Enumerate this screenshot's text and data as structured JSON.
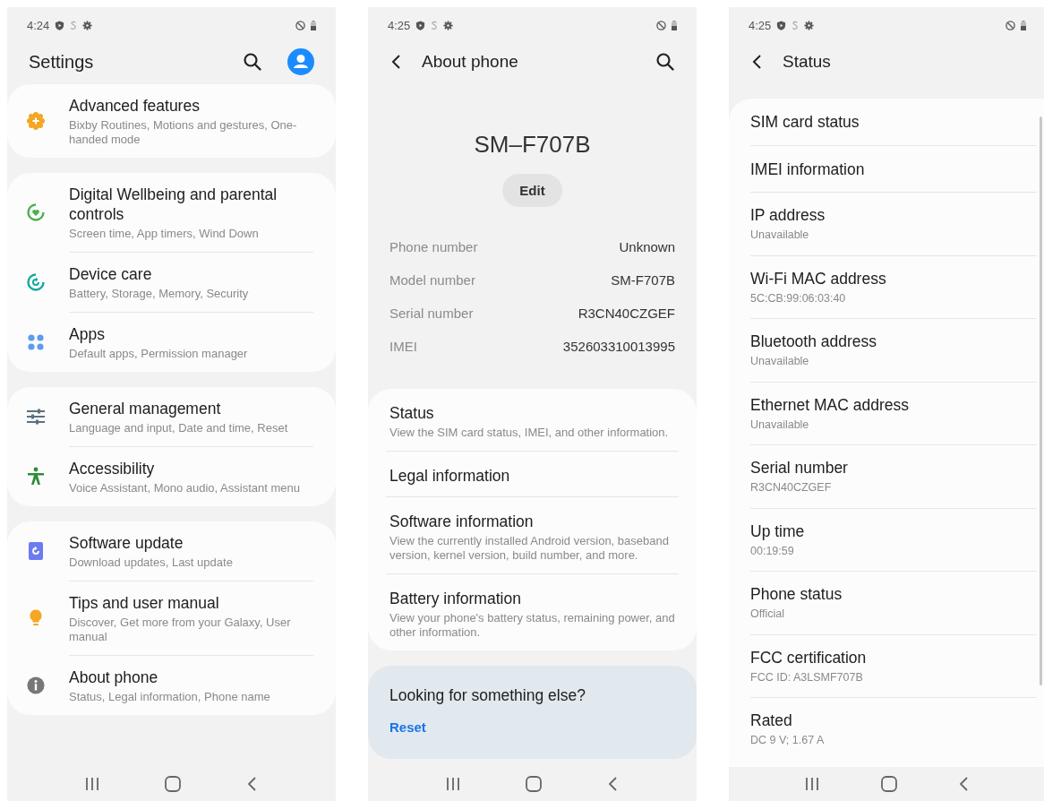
{
  "screens": [
    {
      "kind": "settings",
      "status_bar": {
        "time": "4:24"
      },
      "title": "Settings",
      "groups": [
        [
          {
            "title": "Advanced features",
            "subtitle": "Bixby Routines, Motions and gestures, One-handed mode"
          }
        ],
        [
          {
            "title": "Digital Wellbeing and parental controls",
            "subtitle": "Screen time, App timers, Wind Down"
          },
          {
            "title": "Device care",
            "subtitle": "Battery, Storage, Memory, Security"
          },
          {
            "title": "Apps",
            "subtitle": "Default apps, Permission manager"
          }
        ],
        [
          {
            "title": "General management",
            "subtitle": "Language and input, Date and time, Reset"
          },
          {
            "title": "Accessibility",
            "subtitle": "Voice Assistant, Mono audio, Assistant menu"
          }
        ],
        [
          {
            "title": "Software update",
            "subtitle": "Download updates, Last update"
          },
          {
            "title": "Tips and user manual",
            "subtitle": "Discover, Get more from your Galaxy, User manual"
          },
          {
            "title": "About phone",
            "subtitle": "Status, Legal information, Phone name"
          }
        ]
      ]
    },
    {
      "kind": "about",
      "status_bar": {
        "time": "4:25"
      },
      "title": "About phone",
      "device_name": "SM–F707B",
      "edit_button": "Edit",
      "info": [
        {
          "label": "Phone number",
          "value": "Unknown"
        },
        {
          "label": "Model number",
          "value": "SM-F707B"
        },
        {
          "label": "Serial number",
          "value": "R3CN40CZGEF"
        },
        {
          "label": "IMEI",
          "value": "352603310013995"
        }
      ],
      "items": [
        {
          "title": "Status",
          "subtitle": "View the SIM card status, IMEI, and other information."
        },
        {
          "title": "Legal information"
        },
        {
          "title": "Software information",
          "subtitle": "View the currently installed Android version, baseband version, kernel version, build number, and more."
        },
        {
          "title": "Battery information",
          "subtitle": "View your phone's battery status, remaining power, and other information."
        }
      ],
      "suggestion": {
        "title": "Looking for something else?",
        "link": "Reset"
      }
    },
    {
      "kind": "status",
      "status_bar": {
        "time": "4:25"
      },
      "title": "Status",
      "items": [
        {
          "title": "SIM card status"
        },
        {
          "title": "IMEI information"
        },
        {
          "title": "IP address",
          "value": "Unavailable"
        },
        {
          "title": "Wi-Fi MAC address",
          "value": "5C:CB:99:06:03:40"
        },
        {
          "title": "Bluetooth address",
          "value": "Unavailable"
        },
        {
          "title": "Ethernet MAC address",
          "value": "Unavailable"
        },
        {
          "title": "Serial number",
          "value": "R3CN40CZGEF"
        },
        {
          "title": "Up time",
          "value": "00:19:59"
        },
        {
          "title": "Phone status",
          "value": "Official"
        },
        {
          "title": "FCC certification",
          "value": "FCC ID: A3LSMF707B"
        },
        {
          "title": "Rated",
          "value": "DC 9 V; 1.67 A"
        }
      ]
    }
  ]
}
